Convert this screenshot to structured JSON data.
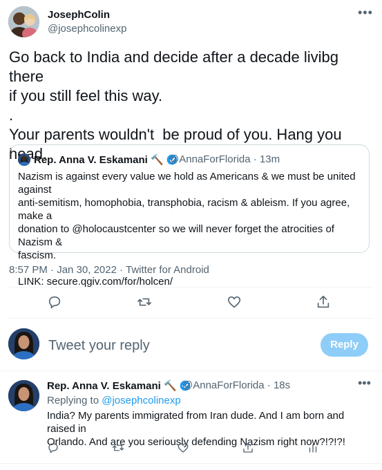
{
  "tweet": {
    "author_name": "JosephColin",
    "author_handle": "@josephcolinexp",
    "body": "Go back to India and decide after a decade livibg there\nif you still feel this way.\n.\nYour parents wouldn't  be proud of you. Hang you\nhead.",
    "timestamp": "8:57 PM · Jan 30, 2022 · Twitter for Android"
  },
  "quote": {
    "author_name": "Rep. Anna V. Eskamani",
    "hammer": "🔨",
    "author_handle": "@AnnaForFlorida · 13m",
    "body": "Nazism is against every value we hold as Americans & we must be united against\nanti-semitism, homophobia, transphobia, racism & ableism. If you agree, make a\ndonation to @holocaustcenter so we will never forget the atrocities of Nazism &\nfascism.\n\nLINK: secure.qgiv.com/for/holcen/"
  },
  "composer": {
    "placeholder": "Tweet your reply",
    "reply_button": "Reply"
  },
  "reply": {
    "author_name": "Rep. Anna V. Eskamani",
    "hammer": "🔨",
    "author_handle": "@AnnaForFlorida · 18s",
    "replying_label": "Replying to ",
    "replying_to": "@josephcolinexp",
    "body": "India? My parents immigrated from Iran dude. And I am born and raised in\nOrlando. And are you seriously defending Nazism right now?!?!?!"
  },
  "icons": {
    "more": "more-icon",
    "reply": "reply-icon",
    "retweet": "retweet-icon",
    "like": "like-icon",
    "share": "share-icon",
    "analytics": "analytics-icon",
    "verified": "verified-badge-icon"
  },
  "colors": {
    "accent": "#1d9bf0",
    "reply_button_disabled": "#8ecdf8",
    "secondary_text": "#536471",
    "border": "#cfd9de"
  }
}
